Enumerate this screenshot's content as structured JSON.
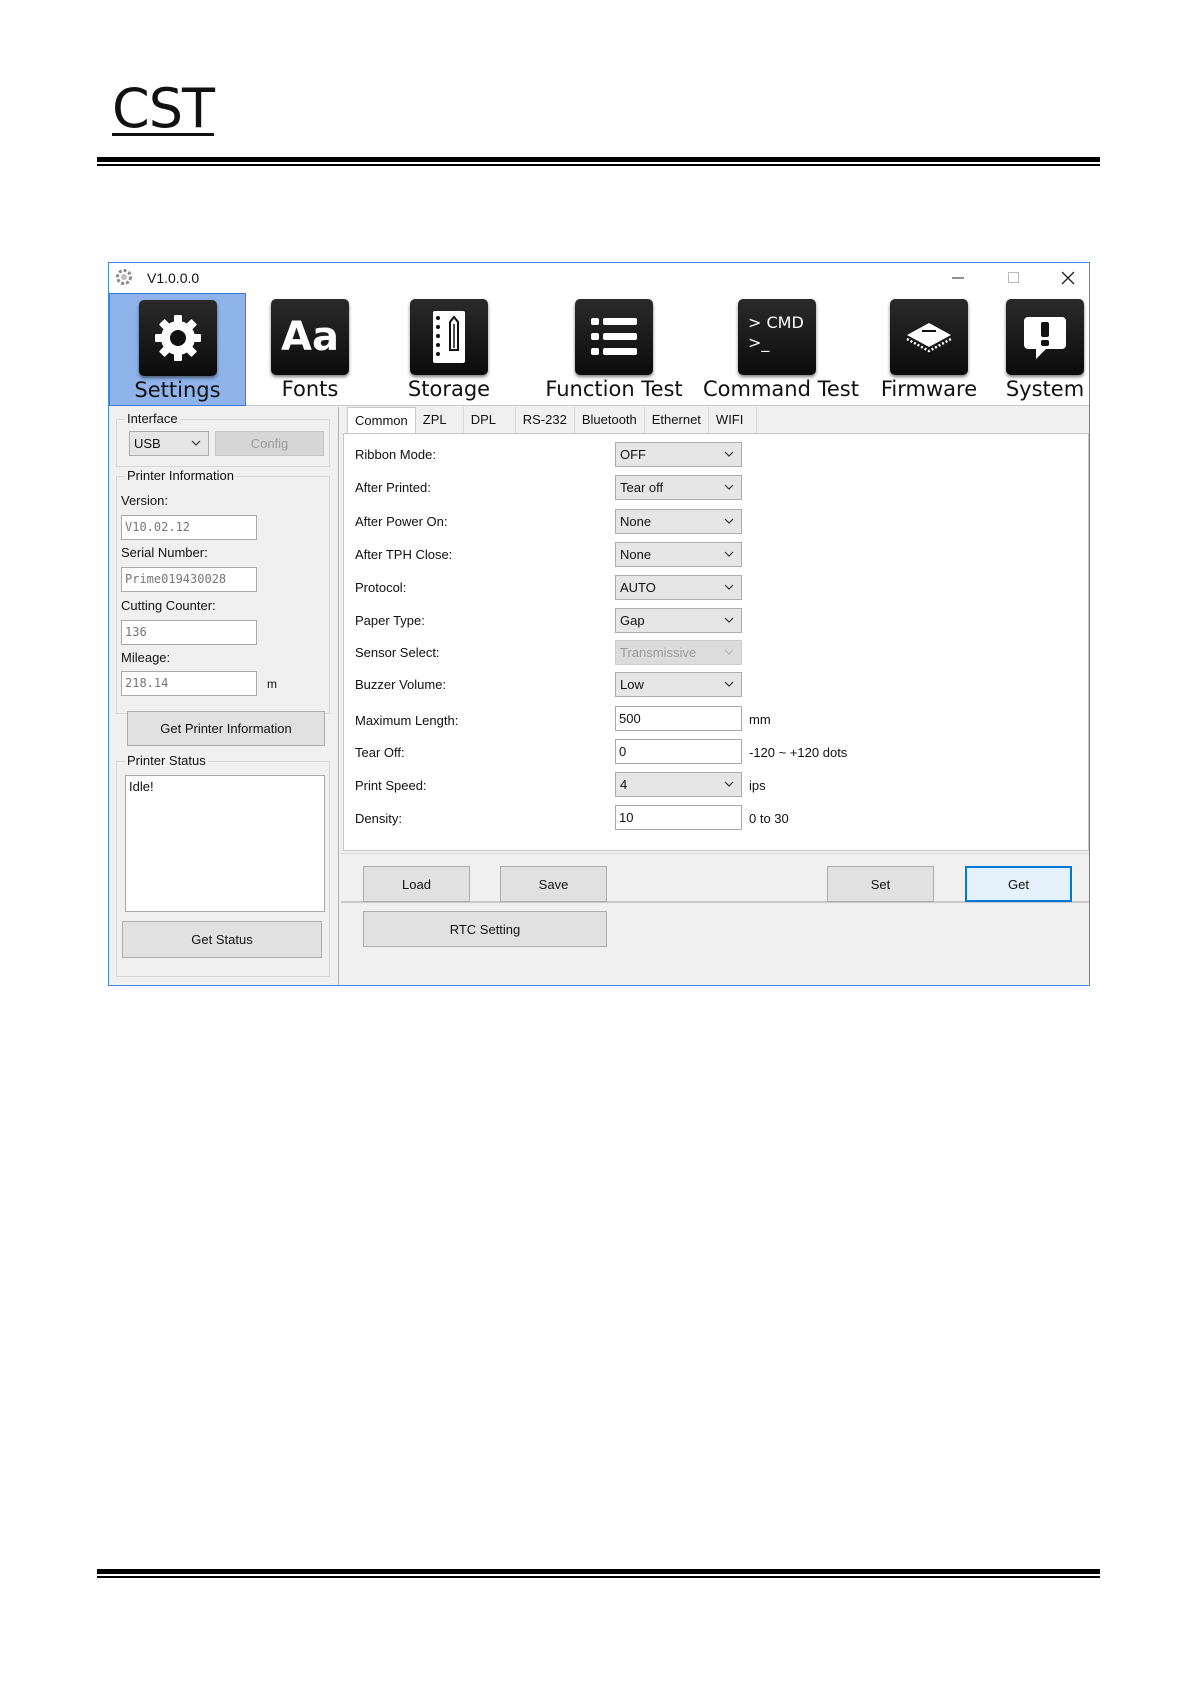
{
  "doc": {
    "header": "CST"
  },
  "window": {
    "title": "V1.0.0.0",
    "controls": {
      "minimize": "—",
      "maximize": "☐",
      "close": "✕"
    }
  },
  "toolbar": [
    {
      "label": "Settings",
      "icon": "gear-icon",
      "active": true
    },
    {
      "label": "Fonts",
      "icon": "fonts-icon",
      "active": false
    },
    {
      "label": "Storage",
      "icon": "storage-notebook-icon",
      "active": false
    },
    {
      "label": "Function Test",
      "icon": "list-icon",
      "active": false
    },
    {
      "label": "Command Test",
      "icon": "cmd-terminal-icon",
      "active": false
    },
    {
      "label": "Firmware",
      "icon": "chip-icon",
      "active": false
    },
    {
      "label": "System",
      "icon": "exclamation-icon",
      "active": false
    }
  ],
  "cmd_icon_text": {
    "line1": "> CMD",
    "line2": ">_"
  },
  "fonts_icon_text": "Aa",
  "left": {
    "interface": {
      "title": "Interface",
      "selected": "USB",
      "config": "Config"
    },
    "info": {
      "title": "Printer Information",
      "version_label": "Version:",
      "version": "V10.02.12",
      "serial_label": "Serial Number:",
      "serial": "Prime019430028",
      "cutting_label": "Cutting Counter:",
      "cutting": "136",
      "mileage_label": "Mileage:",
      "mileage": "218.14",
      "mileage_unit": "m",
      "get_info": "Get Printer Information"
    },
    "status": {
      "title": "Printer Status",
      "text": "Idle!",
      "get_status": "Get Status"
    }
  },
  "tabs": [
    "Common",
    "ZPL",
    "DPL",
    "RS-232",
    "Bluetooth",
    "Ethernet",
    "WIFI"
  ],
  "settings": [
    {
      "label": "Ribbon Mode:",
      "value": "OFF",
      "kind": "combo"
    },
    {
      "label": "After Printed:",
      "value": "Tear off",
      "kind": "combo"
    },
    {
      "label": "After Power On:",
      "value": "None",
      "kind": "combo"
    },
    {
      "label": "After TPH Close:",
      "value": "None",
      "kind": "combo"
    },
    {
      "label": "Protocol:",
      "value": "AUTO",
      "kind": "combo"
    },
    {
      "label": "Paper Type:",
      "value": "Gap",
      "kind": "combo"
    },
    {
      "label": "Sensor Select:",
      "value": "Transmissive",
      "kind": "combo-disabled"
    },
    {
      "label": "Buzzer Volume:",
      "value": "Low",
      "kind": "combo"
    },
    {
      "label": "Maximum Length:",
      "value": "500",
      "kind": "text",
      "unit": "mm"
    },
    {
      "label": "Tear Off:",
      "value": "0",
      "kind": "text",
      "unit": "-120 ~ +120 dots"
    },
    {
      "label": "Print Speed:",
      "value": "4",
      "kind": "combo",
      "unit": "ips"
    },
    {
      "label": "Density:",
      "value": "10",
      "kind": "text",
      "unit": "0 to 30"
    }
  ],
  "buttons": {
    "load": "Load",
    "save": "Save",
    "set": "Set",
    "get": "Get",
    "rtc": "RTC Setting"
  }
}
